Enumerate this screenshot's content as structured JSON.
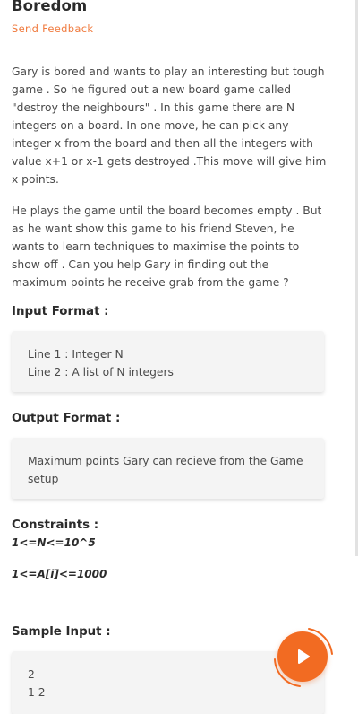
{
  "header": {
    "title": "Boredom",
    "feedback_link": "Send Feedback"
  },
  "description": {
    "paragraph1": "Gary is bored and wants to play an interesting but tough game . So he figured out a new board game called \"destroy the neighbours\" . In this game there are N integers on a board. In one move, he can pick any integer x from the board and then all the integers with value x+1 or x-1 gets destroyed .This move will give him x points.",
    "paragraph2": "He plays the game until the board becomes empty . But as he want show this game to his friend Steven, he wants to learn techniques to maximise the points to show off . Can you help Gary in finding out the maximum points he receive grab from the game ?"
  },
  "input_format": {
    "heading": "Input Format :",
    "lines": [
      "Line 1 : Integer N",
      "Line 2 : A list of N integers"
    ]
  },
  "output_format": {
    "heading": "Output Format :",
    "text": "Maximum points Gary can recieve from the Game setup"
  },
  "constraints": {
    "heading": "Constraints :",
    "items": [
      "1<=N<=10^5",
      "1<=A[i]<=1000"
    ]
  },
  "sample_input": {
    "heading": "Sample Input :",
    "lines": [
      "2",
      "1 2"
    ]
  },
  "colors": {
    "accent": "#f07b3f",
    "play_button": "#f26b22",
    "box_background": "#f4f4f4"
  },
  "icons": {
    "play": "play-icon"
  }
}
